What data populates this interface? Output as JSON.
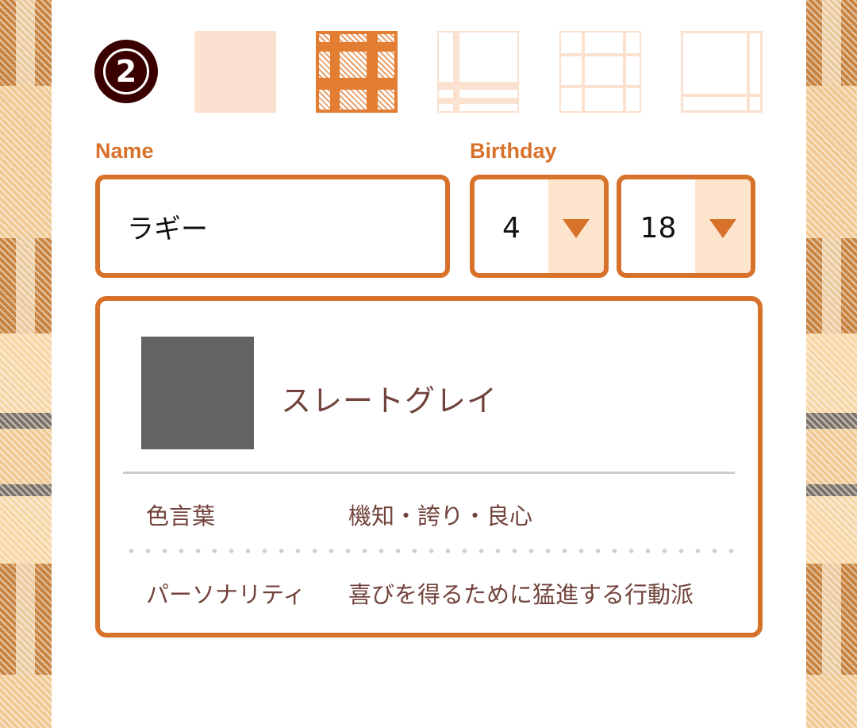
{
  "step": {
    "number": "2"
  },
  "patterns": [
    {
      "name": "solid-peach"
    },
    {
      "name": "orange-gingham"
    },
    {
      "name": "faint-tartan"
    },
    {
      "name": "faint-grid"
    },
    {
      "name": "faint-windowpane"
    }
  ],
  "form": {
    "name_label": "Name",
    "name_value": "ラギー",
    "birthday_label": "Birthday",
    "month_value": "4",
    "day_value": "18"
  },
  "result": {
    "color_hex": "#636363",
    "color_name": "スレートグレイ",
    "rows": [
      {
        "label": "色言葉",
        "value": "機知・誇り・良心"
      },
      {
        "label": "パーソナリティ",
        "value": "喜びを得るために猛進する行動派"
      }
    ]
  },
  "colors": {
    "accent": "#d8722b",
    "text_brown": "#72433c",
    "badge": "#3a0000",
    "arrow_bg": "#fde4cc"
  }
}
